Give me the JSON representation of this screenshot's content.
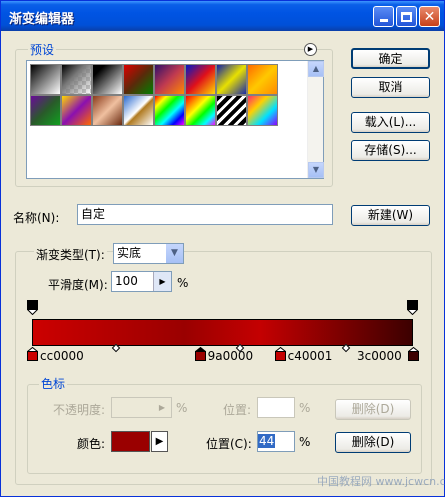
{
  "window": {
    "title": "渐变编辑器"
  },
  "presets": {
    "legend": "预设",
    "swatches": [
      {
        "name": "black-white",
        "css": "linear-gradient(135deg,#000 0%,#fff 100%)"
      },
      {
        "name": "black-transparent",
        "css": "linear-gradient(135deg,#000 0%,#7a7a7a 40%,transparent 100%)"
      },
      {
        "name": "black-white-alt",
        "css": "linear-gradient(135deg,#000 20%,#fff 100%)"
      },
      {
        "name": "red-green",
        "css": "linear-gradient(135deg,#d00 0%,#5a2a0a 50%,#008000 100%)"
      },
      {
        "name": "violet-orange",
        "css": "linear-gradient(135deg,#30106a 0%,#c03a50 50%,#ff8a00 100%)"
      },
      {
        "name": "blue-red-yellow",
        "css": "linear-gradient(135deg,#0018c8 0%,#e0101a 50%,#ffd800 100%)"
      },
      {
        "name": "blue-yellow-blue",
        "css": "linear-gradient(135deg,#1020a8 0%,#e8e000 50%,#1a2aa8 100%)"
      },
      {
        "name": "orange-yellow",
        "css": "linear-gradient(135deg,#ff6a00 0%,#ffc800 50%,#ff8a00 100%)"
      },
      {
        "name": "violet-green",
        "css": "linear-gradient(135deg,#6a0a9a 0%,#2a5a2a 50%,#10a020 100%)"
      },
      {
        "name": "yellow-violet-orange",
        "css": "linear-gradient(135deg,#ffd800 0%,#8a10b0 50%,#ff6a00 100%)"
      },
      {
        "name": "copper",
        "css": "linear-gradient(135deg,#8a3a1a 0%,#f0c0a0 50%,#6a2a10 100%)"
      },
      {
        "name": "chrome",
        "css": "linear-gradient(135deg,#2a6ad0 0%,#ffffff 48%,#b07a20 55%,#ffffff 100%)"
      },
      {
        "name": "spectrum",
        "css": "linear-gradient(135deg,#ff0000,#ffff00,#00ff00,#00ffff,#0000ff,#ff00ff)"
      },
      {
        "name": "transparent-rainbow",
        "css": "linear-gradient(135deg,#ff0000,#ff8000,#ffff00,#00ff00,#00ffff,#ff00ff)"
      },
      {
        "name": "transparent-stripes",
        "css": "repeating-linear-gradient(135deg,#000 0 4px,#fff 4px 7px)"
      },
      {
        "name": "rainbow-stripes",
        "css": "linear-gradient(135deg,#ff2a6a,#ffd000,#00e0ff,#8a00ff)"
      }
    ]
  },
  "buttons": {
    "ok": "确定",
    "cancel": "取消",
    "load": "载入(L)...",
    "save": "存储(S)...",
    "new": "新建(W)"
  },
  "name": {
    "label": "名称(N):",
    "value": "自定"
  },
  "gradient": {
    "type_label": "渐变类型(T):",
    "type_value": "实底",
    "smooth_label": "平滑度(M):",
    "smooth_value": "100",
    "percent": "%",
    "bar_css": "linear-gradient(to right,#cc0000 0%,#9a0000 40%,#c40001 60%,#3c0000 100%)",
    "color_stops": [
      {
        "label": "cc0000",
        "color": "#cc0000",
        "pos": 0
      },
      {
        "label": "9a0000",
        "color": "#9a0000",
        "pos": 44
      },
      {
        "label": "c40001",
        "color": "#c40001",
        "pos": 65
      },
      {
        "label": "3c0000",
        "color": "#3c0000",
        "pos": 100
      }
    ]
  },
  "stops": {
    "legend": "色标",
    "opacity_label": "不透明度:",
    "opacity_value": "",
    "position_label_1": "位置:",
    "position_value_1": "",
    "delete_label_1": "删除(D)",
    "color_label": "颜色:",
    "color_value": "#9a0000",
    "position_label_2": "位置(C):",
    "position_value_2": "44",
    "delete_label_2": "删除(D)",
    "percent": "%"
  },
  "watermark": "中国教程网 www.jcwcn.com"
}
